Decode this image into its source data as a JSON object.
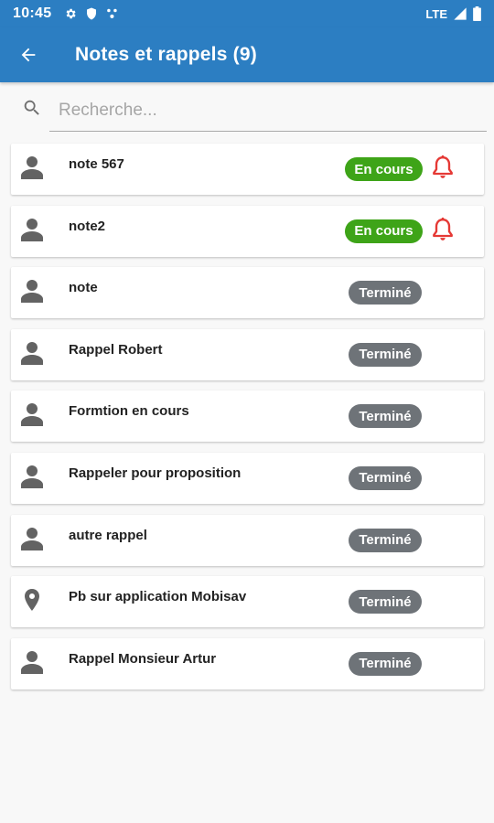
{
  "status_bar": {
    "time": "10:45",
    "network": "LTE",
    "icons": [
      "gear-icon",
      "shield-icon",
      "dots-icon",
      "signal-icon",
      "battery-icon"
    ]
  },
  "app_bar": {
    "title": "Notes et rappels (9)",
    "back_icon": "arrow-left-icon",
    "color": "#2c7ec2"
  },
  "search": {
    "placeholder": "Recherche...",
    "value": ""
  },
  "colors": {
    "in_progress": "#3ea418",
    "done": "#6e7378",
    "bell": "#e53935"
  },
  "items": [
    {
      "label": "note 567",
      "status": "En cours",
      "icon": "person-icon",
      "reminder": true
    },
    {
      "label": "note2",
      "status": "En cours",
      "icon": "person-icon",
      "reminder": true
    },
    {
      "label": "note",
      "status": "Terminé",
      "icon": "person-icon",
      "reminder": false
    },
    {
      "label": "Rappel Robert",
      "status": "Terminé",
      "icon": "person-icon",
      "reminder": false
    },
    {
      "label": "Formtion en cours",
      "status": "Terminé",
      "icon": "person-icon",
      "reminder": false
    },
    {
      "label": "Rappeler pour proposition",
      "status": "Terminé",
      "icon": "person-icon",
      "reminder": false
    },
    {
      "label": "autre rappel",
      "status": "Terminé",
      "icon": "person-icon",
      "reminder": false
    },
    {
      "label": "Pb sur application Mobisav",
      "status": "Terminé",
      "icon": "location-pin-icon",
      "reminder": false
    },
    {
      "label": "Rappel Monsieur Artur",
      "status": "Terminé",
      "icon": "person-icon",
      "reminder": false
    }
  ]
}
